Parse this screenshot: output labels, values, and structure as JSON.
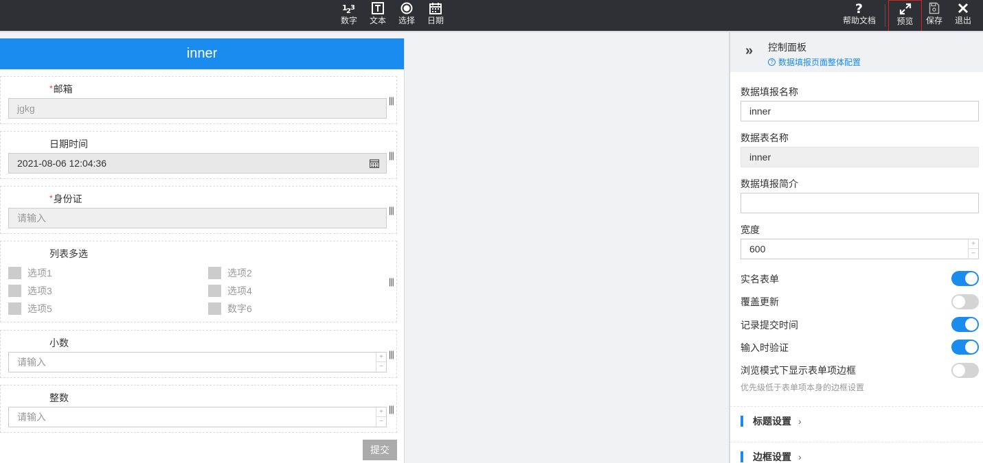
{
  "toolbar": {
    "left_tools": [
      {
        "icon": "number-icon",
        "label": "数字"
      },
      {
        "icon": "text-icon",
        "label": "文本"
      },
      {
        "icon": "radio-icon",
        "label": "选择"
      },
      {
        "icon": "calendar-icon",
        "label": "日期"
      }
    ],
    "right_tools": [
      {
        "icon": "help-icon",
        "label": "帮助文档"
      },
      {
        "icon": "expand-icon",
        "label": "预览"
      },
      {
        "icon": "save-icon",
        "label": "保存"
      },
      {
        "icon": "close-icon",
        "label": "退出"
      }
    ]
  },
  "form": {
    "title": "inner",
    "fields": {
      "email": {
        "label": "邮箱",
        "required": "*",
        "value": "jgkg"
      },
      "datetime": {
        "label": "日期时间",
        "value": "2021-08-06 12:04:36"
      },
      "idcard": {
        "label": "身份证",
        "required": "*",
        "placeholder": "请输入"
      },
      "multiselect": {
        "label": "列表多选",
        "options": [
          "选项1",
          "选项2",
          "选项3",
          "选项4",
          "选项5",
          "数字6"
        ]
      },
      "decimal": {
        "label": "小数",
        "placeholder": "请输入"
      },
      "integer": {
        "label": "整数",
        "placeholder": "请输入"
      }
    },
    "handle_glyph": "|||",
    "stepper": {
      "plus": "+",
      "minus": "−"
    },
    "submit_label": "提交"
  },
  "control_panel": {
    "title": "控制面板",
    "subtitle": "数据填报页面整体配置",
    "help_glyph": "?",
    "collapse_glyph": "»",
    "name_label": "数据填报名称",
    "name_value": "inner",
    "table_label": "数据表名称",
    "table_value": "inner",
    "intro_label": "数据填报简介",
    "intro_value": "",
    "width_label": "宽度",
    "width_value": "600",
    "toggles": [
      {
        "label": "实名表单",
        "on": true
      },
      {
        "label": "覆盖更新",
        "on": false
      },
      {
        "label": "记录提交时间",
        "on": true
      },
      {
        "label": "输入时验证",
        "on": true
      },
      {
        "label": "浏览模式下显示表单项边框",
        "on": false
      }
    ],
    "border_hint": "优先级低于表单项本身的边框设置",
    "sections": [
      {
        "label": "标题设置"
      },
      {
        "label": "边框设置"
      }
    ],
    "chevron_glyph": "›"
  },
  "colors": {
    "accent": "#1a8cf0",
    "toolbar_bg": "#2d3035",
    "required": "#e33333",
    "preview_highlight": "#e02020"
  }
}
